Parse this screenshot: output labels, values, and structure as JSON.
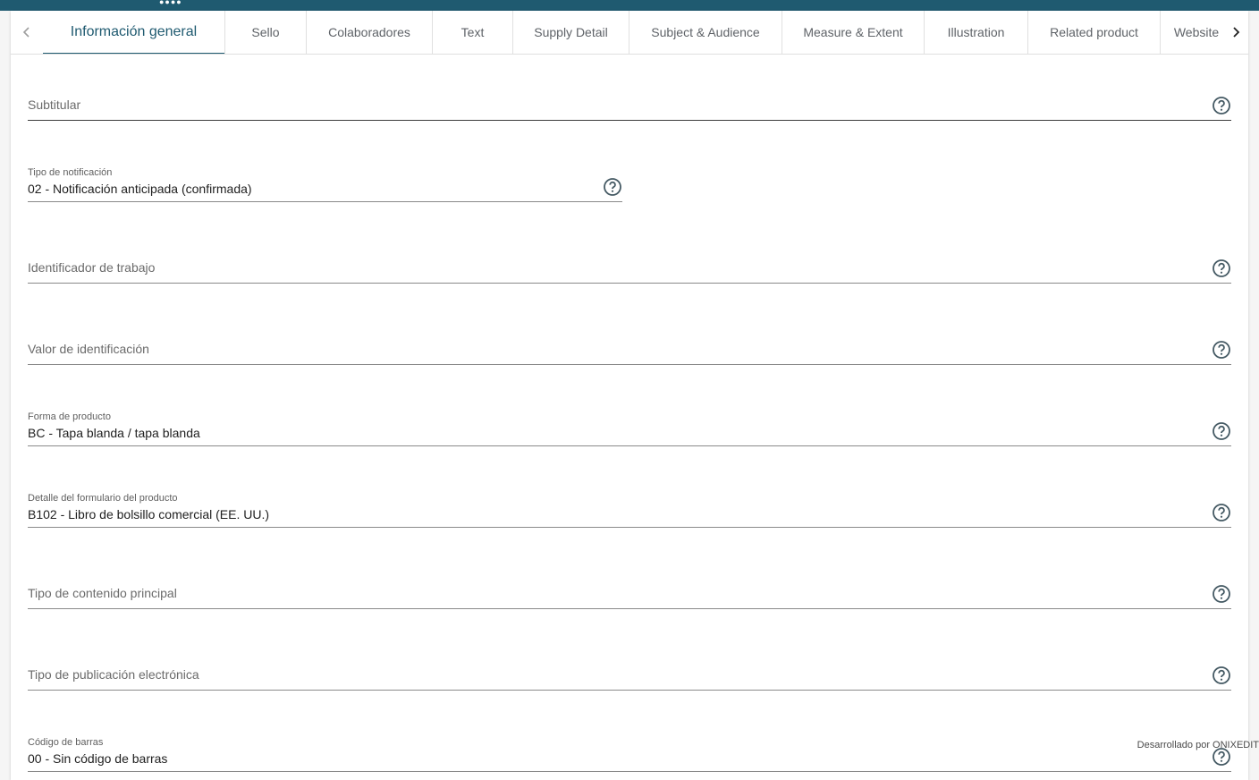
{
  "tabs": [
    {
      "label": "Información general",
      "active": true
    },
    {
      "label": "Sello"
    },
    {
      "label": "Colaboradores"
    },
    {
      "label": "Text"
    },
    {
      "label": "Supply Detail"
    },
    {
      "label": "Subject & Audience"
    },
    {
      "label": "Measure & Extent"
    },
    {
      "label": "Illustration"
    },
    {
      "label": "Related product"
    },
    {
      "label": "Website"
    }
  ],
  "fields": {
    "subtitle": {
      "placeholder": "Subtitular"
    },
    "notification_type": {
      "label": "Tipo de notificación",
      "value": "02 - Notificación anticipada (confirmada)"
    },
    "work_identifier": {
      "placeholder": "Identificador de trabajo"
    },
    "id_value": {
      "placeholder": "Valor de identificación"
    },
    "product_form": {
      "label": "Forma de producto",
      "value": "BC - Tapa blanda / tapa blanda"
    },
    "product_form_detail": {
      "label": "Detalle del formulario del producto",
      "value": "B102 - Libro de bolsillo comercial (EE. UU.)"
    },
    "primary_content_type": {
      "placeholder": "Tipo de contenido principal"
    },
    "epub_type": {
      "placeholder": "Tipo de publicación electrónica"
    },
    "barcode": {
      "label": "Código de barras",
      "value": "00 - Sin código de barras"
    }
  },
  "footer": {
    "credit": "Desarrollado por ONIXEDIT"
  },
  "colors": {
    "brand": "#1f5a70",
    "help_icon": "#455a64"
  },
  "icons": {
    "help": "help-circle-icon",
    "prev": "chevron-left-icon",
    "next": "chevron-right-icon"
  }
}
